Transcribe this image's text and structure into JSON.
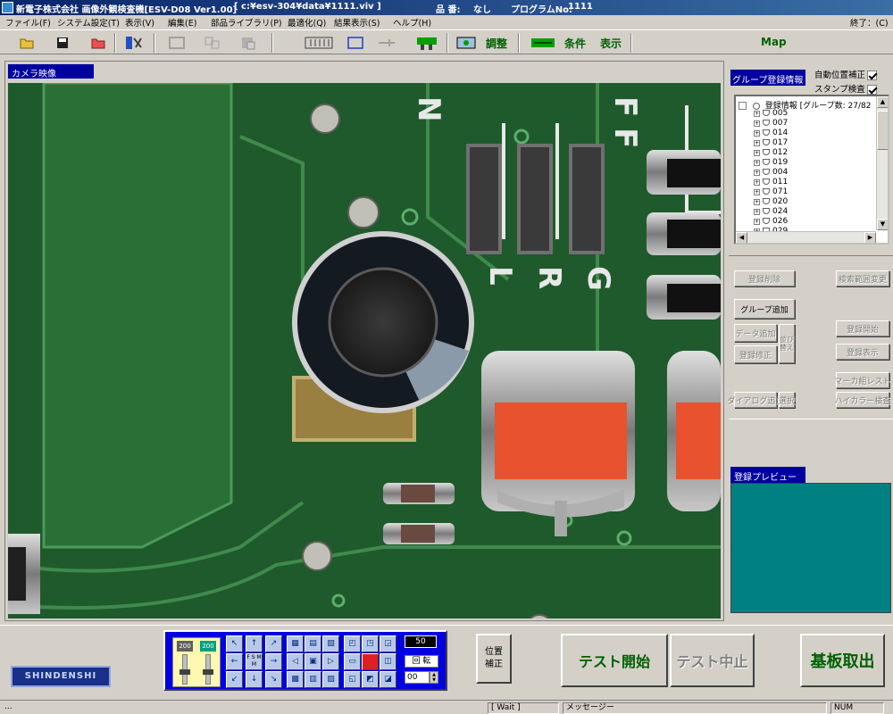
{
  "window": {
    "title_main": "新電子株式会社 画像外観検査機[ESV-D08  Ver1.00]",
    "title_path": "[ c:¥esv-304¥data¥1111.viv ]",
    "part_label": "品 番:",
    "part_value": "なし",
    "program_label": "プログラムNo:",
    "program_value": "1111"
  },
  "menu": {
    "items": [
      "ファイル(F)",
      "システム設定(T)",
      "表示(V)",
      "編集(E)",
      "部品ライブラリ(P)",
      "最適化(Q)",
      "結果表示(S)",
      "ヘルプ(H)"
    ],
    "right": "終了：(C)"
  },
  "toolbar": {
    "adjust": "調整",
    "condition": "条件",
    "display": "表示",
    "map": "Map"
  },
  "camera": {
    "title": "カメラ映像",
    "silk": [
      "N",
      "F F",
      "L",
      "R",
      "G"
    ]
  },
  "group_panel": {
    "title": "グループ登録情報",
    "auto_position": "自動位置補正",
    "stamp": "スタンプ検査",
    "root_label": "登録情報",
    "root_count": "[グループ数: 27/82",
    "items": [
      "005",
      "007",
      "014",
      "017",
      "012",
      "019",
      "004",
      "011",
      "071",
      "020",
      "024",
      "026",
      "029"
    ]
  },
  "buttons": {
    "reg_delete": "登録削除",
    "search_range": "検索範囲変更",
    "group_add": "グループ追加",
    "data_add": "データ追加",
    "side": "並び替え",
    "group_copy": "登録修正",
    "reg_start": "登録開始",
    "reg_view": "登録表示",
    "multi_level": "マーカ組レスト",
    "data_area": "ダイアログ追加",
    "select": "選択",
    "high_color": "ハイカラー検査"
  },
  "preview": {
    "title": "登録プレビュー"
  },
  "jog": {
    "lamp_left": "200",
    "lamp_right": "200",
    "center": "F S M M",
    "speed": "50",
    "rotate": "回 転",
    "rotate_value": "00"
  },
  "actions": {
    "position_correct": "位置\n補正",
    "test_start": "テスト開始",
    "test_stop": "テスト中止",
    "board_eject": "基板取出"
  },
  "logo": "SHINDENSHI",
  "statusbar": {
    "left": "...",
    "wait": "[ Wait ]",
    "message": "メッセージー",
    "num": "NUM"
  },
  "colors": {
    "title_start": "#0a246a",
    "panel_blue": "#0000a0",
    "jog_blue": "#0000e0",
    "action_green": "#006000",
    "preview_teal": "#008080",
    "pcb_green": "#1f5a2c",
    "cap_orange": "#e8522e"
  }
}
